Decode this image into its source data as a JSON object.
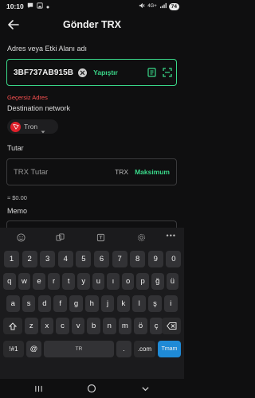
{
  "status_bar": {
    "time": "10:10",
    "network": "4G+",
    "battery": "74"
  },
  "header": {
    "title": "Gönder TRX"
  },
  "address": {
    "label": "Adres veya Etki Alanı adı",
    "value": "3BF737AB915B",
    "paste_label": "Yapıştır",
    "error": "Geçersiz Adres"
  },
  "network": {
    "label": "Destination network",
    "selected": "Tron"
  },
  "amount": {
    "label": "Tutar",
    "placeholder": "TRX Tutar",
    "unit": "TRX",
    "max_label": "Maksimum",
    "fiat": "≈ $0.00"
  },
  "memo": {
    "label": "Memo"
  },
  "keyboard": {
    "toolbar_icons": [
      "emoji-icon",
      "clipboard-icon",
      "translate-icon",
      "settings-icon",
      "more-icon"
    ],
    "rows": [
      [
        "1",
        "2",
        "3",
        "4",
        "5",
        "6",
        "7",
        "8",
        "9",
        "0"
      ],
      [
        "q",
        "w",
        "e",
        "r",
        "t",
        "y",
        "u",
        "ı",
        "o",
        "p",
        "ğ",
        "ü"
      ],
      [
        "a",
        "s",
        "d",
        "f",
        "g",
        "h",
        "j",
        "k",
        "l",
        "ş",
        "i"
      ],
      [
        "z",
        "x",
        "c",
        "v",
        "b",
        "n",
        "m",
        "ö",
        "ç"
      ]
    ],
    "symbols_label": "!#1",
    "at_label": "@",
    "space_label": "TR",
    "dot_label": ".",
    "com_label": ".com",
    "enter_label": "Tmam"
  },
  "colors": {
    "accent": "#3ad98a",
    "error": "#ff5252",
    "tron": "#e0212b",
    "enter": "#1f8ad6"
  }
}
